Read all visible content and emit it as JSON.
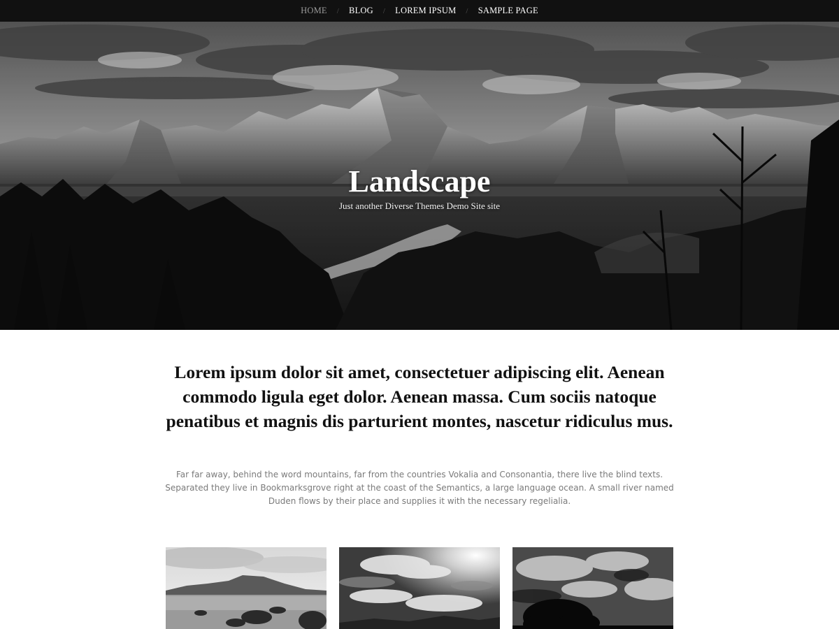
{
  "nav": {
    "items": [
      {
        "label": "HOME",
        "active": true
      },
      {
        "label": "BLOG",
        "active": false
      },
      {
        "label": "LOREM IPSUM",
        "active": false
      },
      {
        "label": "SAMPLE PAGE",
        "active": false
      }
    ],
    "separator": "/"
  },
  "hero": {
    "title": "Landscape",
    "tagline": "Just another Diverse Themes Demo Site site",
    "image": "mountain-landscape-photo"
  },
  "intro": {
    "heading": "Lorem ipsum dolor sit amet, consectetuer adipiscing elit. Aenean commodo ligula eget dolor. Aenean massa. Cum sociis natoque penatibus et magnis dis parturient montes, nascetur ridiculus mus.",
    "text": "Far far away, behind the word mountains, far from the countries Vokalia and Consonantia, there live the blind texts. Separated they live in Bookmarksgrove right at the coast of the Semantics, a large language ocean. A small river named Duden flows by their place and supplies it with the necessary regelialia."
  },
  "thumbnails": [
    {
      "image": "coastal-rocks-photo"
    },
    {
      "image": "cloudy-sky-photo"
    },
    {
      "image": "tree-under-clouds-photo"
    }
  ],
  "colors": {
    "nav_background": "#111111",
    "nav_text": "#ffffff",
    "nav_active": "#9a9a9a",
    "heading_text": "#111111",
    "body_text": "#7a7a7a"
  }
}
